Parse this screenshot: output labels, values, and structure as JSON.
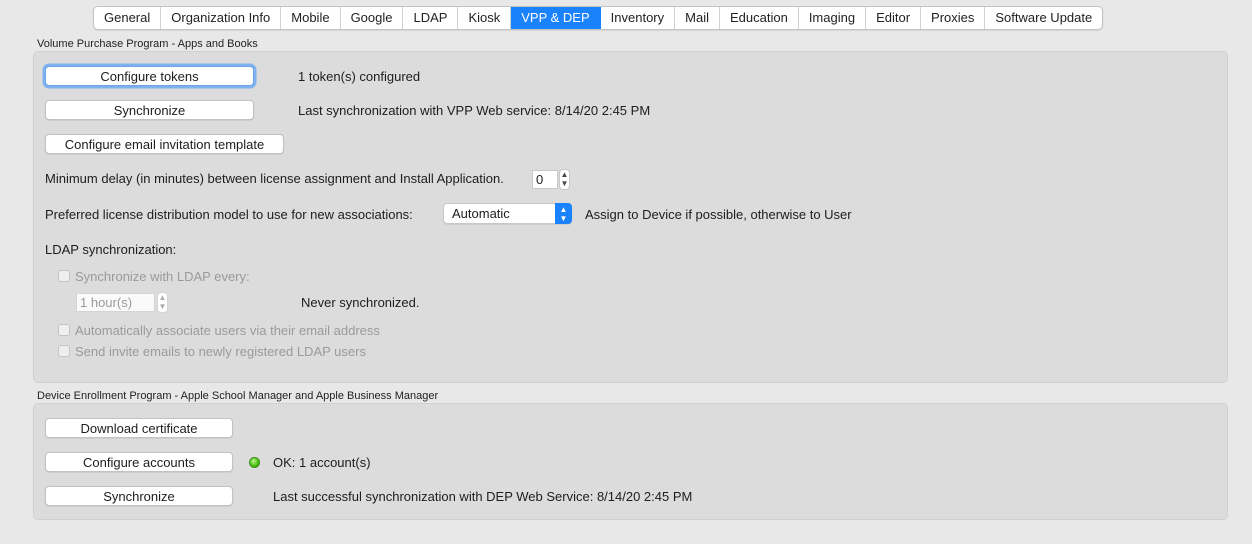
{
  "tabs": [
    "General",
    "Organization Info",
    "Mobile",
    "Google",
    "LDAP",
    "Kiosk",
    "VPP & DEP",
    "Inventory",
    "Mail",
    "Education",
    "Imaging",
    "Editor",
    "Proxies",
    "Software Update"
  ],
  "active_tab": "VPP & DEP",
  "vpp": {
    "title": "Volume Purchase Program - Apps and Books",
    "configure_tokens_label": "Configure tokens",
    "tokens_status": "1 token(s) configured",
    "synchronize_label": "Synchronize",
    "sync_status": "Last synchronization with VPP Web service: 8/14/20 2:45 PM",
    "email_template_label": "Configure email invitation template",
    "min_delay_label": "Minimum delay (in minutes) between license assignment and Install Application.",
    "min_delay_value": "0",
    "license_model_label": "Preferred license distribution model to use for new associations:",
    "license_model_value": "Automatic",
    "license_model_hint": "Assign to Device if possible, otherwise to User",
    "ldap_sync_heading": "LDAP synchronization:",
    "ldap_sync_every_label": "Synchronize with LDAP every:",
    "ldap_interval_value": "1 hour(s)",
    "ldap_never_synced": "Never synchronized.",
    "auto_associate_label": "Automatically associate users via their email address",
    "send_invite_label": "Send invite emails to newly registered LDAP users"
  },
  "dep": {
    "title": "Device Enrollment Program - Apple School Manager and Apple Business Manager",
    "download_cert_label": "Download certificate",
    "configure_accounts_label": "Configure accounts",
    "accounts_status": "OK: 1 account(s)",
    "synchronize_label": "Synchronize",
    "sync_status": "Last successful synchronization with DEP Web Service: 8/14/20 2:45 PM"
  },
  "colors": {
    "accent": "#1a82fb",
    "status_ok": "#4fc318"
  }
}
